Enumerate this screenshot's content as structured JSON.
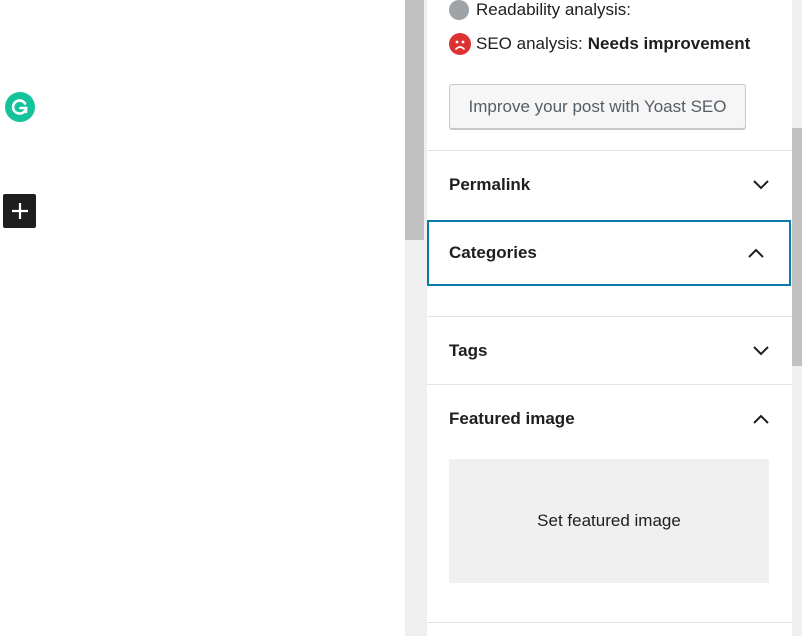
{
  "editor": {
    "grammarly_icon": "grammarly-icon",
    "add_block_icon": "plus-icon"
  },
  "yoast": {
    "readability_label": "Readability analysis:",
    "seo_label": "SEO analysis:",
    "seo_status": "Needs improvement",
    "improve_button": "Improve your post with Yoast SEO",
    "colors": {
      "neutral": "#9ea3a8",
      "bad": "#dc3232"
    }
  },
  "panels": {
    "permalink": {
      "label": "Permalink",
      "expanded": false
    },
    "categories": {
      "label": "Categories",
      "expanded": true
    },
    "tags": {
      "label": "Tags",
      "expanded": false
    },
    "featured_image": {
      "label": "Featured image",
      "expanded": true,
      "button": "Set featured image"
    }
  },
  "colors": {
    "focus": "#0a7aa8",
    "grammarly": "#15c39a"
  }
}
